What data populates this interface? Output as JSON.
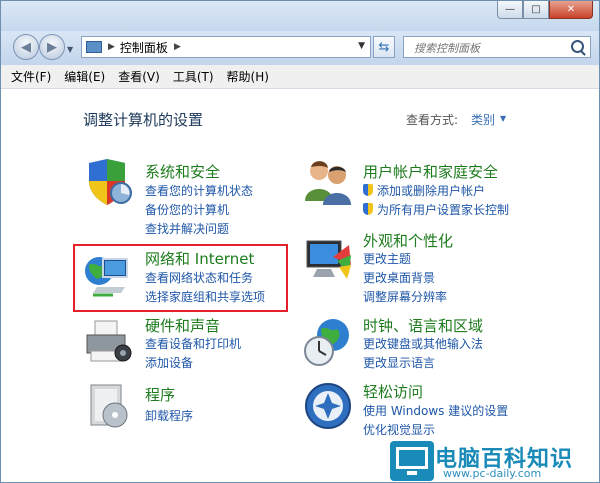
{
  "window": {
    "caption_buttons": {
      "minimize": "—",
      "maximize": "□",
      "close": "✕"
    }
  },
  "navbar": {
    "address_path": "控制面板",
    "search_placeholder": "搜索控制面板"
  },
  "menubar": {
    "items": [
      "文件(F)",
      "编辑(E)",
      "查看(V)",
      "工具(T)",
      "帮助(H)"
    ]
  },
  "content": {
    "heading": "调整计算机的设置",
    "view_by_label": "查看方式:",
    "view_by_value": "类别",
    "categories": [
      {
        "title": "系统和安全",
        "icon": "shield-icon",
        "links": [
          "查看您的计算机状态",
          "备份您的计算机",
          "查找并解决问题"
        ]
      },
      {
        "title": "网络和 Internet",
        "icon": "network-icon",
        "links": [
          "查看网络状态和任务",
          "选择家庭组和共享选项"
        ]
      },
      {
        "title": "硬件和声音",
        "icon": "printer-icon",
        "links": [
          "查看设备和打印机",
          "添加设备"
        ]
      },
      {
        "title": "程序",
        "icon": "programs-icon",
        "links": [
          "卸载程序"
        ]
      },
      {
        "title": "用户帐户和家庭安全",
        "icon": "users-icon",
        "links": [
          "添加或删除用户帐户",
          "为所有用户设置家长控制"
        ]
      },
      {
        "title": "外观和个性化",
        "icon": "monitor-icon",
        "links": [
          "更改主题",
          "更改桌面背景",
          "调整屏幕分辨率"
        ]
      },
      {
        "title": "时钟、语言和区域",
        "icon": "clock-globe-icon",
        "links": [
          "更改键盘或其他输入法",
          "更改显示语言"
        ]
      },
      {
        "title": "轻松访问",
        "icon": "accessibility-icon",
        "links": [
          "使用 Windows 建议的设置",
          "优化视觉显示"
        ]
      }
    ]
  },
  "watermark": {
    "text": "电脑百科知识",
    "url": "www.pc-daily.com"
  },
  "colors": {
    "category_title": "#1e7b1e",
    "link": "#1f57a8",
    "highlight": "#e4212b",
    "watermark": "#1a8ab8"
  }
}
